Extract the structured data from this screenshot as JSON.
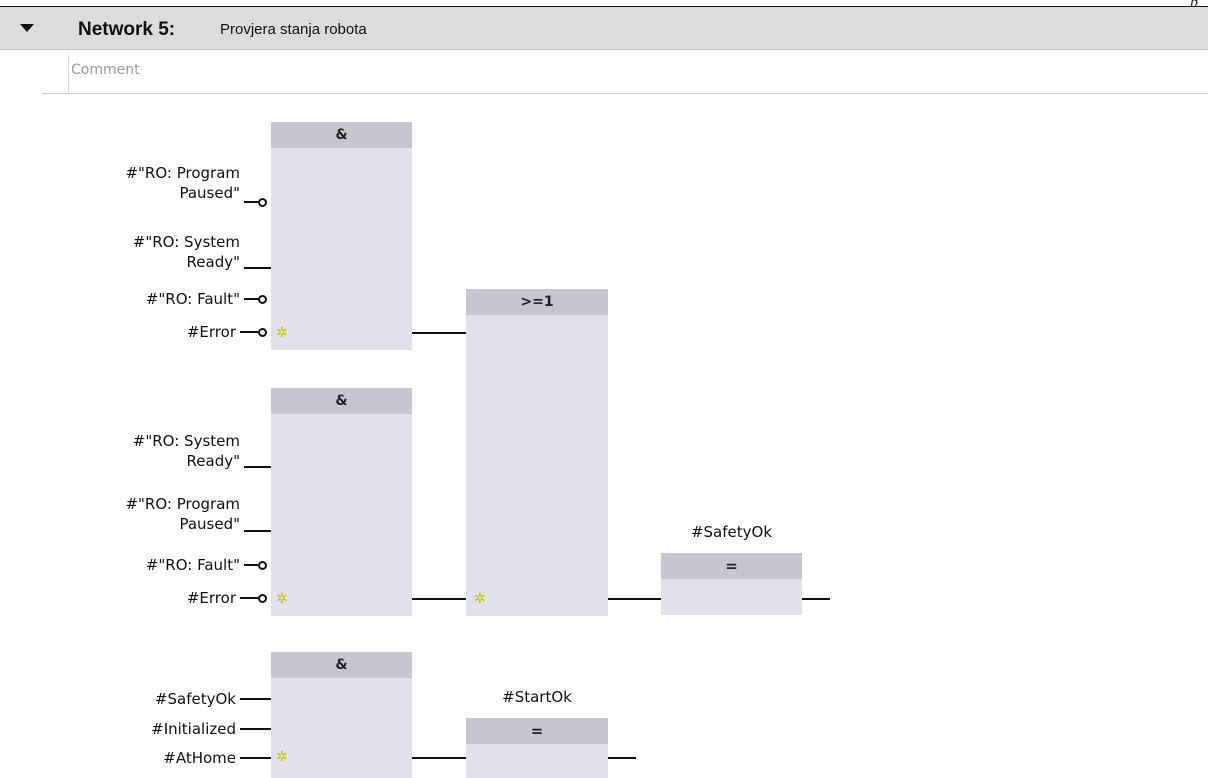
{
  "header": {
    "page_mark": "p",
    "network_label": "Network 5:",
    "network_description": "Provjera stanja robota"
  },
  "comment": {
    "placeholder": "Comment"
  },
  "blocks": {
    "and1": {
      "op": "&",
      "inputs": [
        "#\"RO: Program\n      Paused\"",
        "#\"RO: System\n       Ready\"",
        "#\"RO: Fault\"",
        "#Error"
      ]
    },
    "and2": {
      "op": "&",
      "inputs": [
        "#\"RO: System\n       Ready\"",
        "#\"RO: Program\n      Paused\"",
        "#\"RO: Fault\"",
        "#Error"
      ]
    },
    "or1": {
      "op": ">=1"
    },
    "coil1": {
      "op": "=",
      "operand": "#SafetyOk"
    },
    "and3": {
      "op": "&",
      "inputs": [
        "#SafetyOk",
        "#Initialized",
        "#AtHome"
      ]
    },
    "coil2": {
      "op": "=",
      "operand": "#StartOk"
    }
  },
  "icons": {
    "expand": "collapse-arrow-icon",
    "new-input": "insert-input-star-icon",
    "negation": "negation-circle-icon"
  }
}
